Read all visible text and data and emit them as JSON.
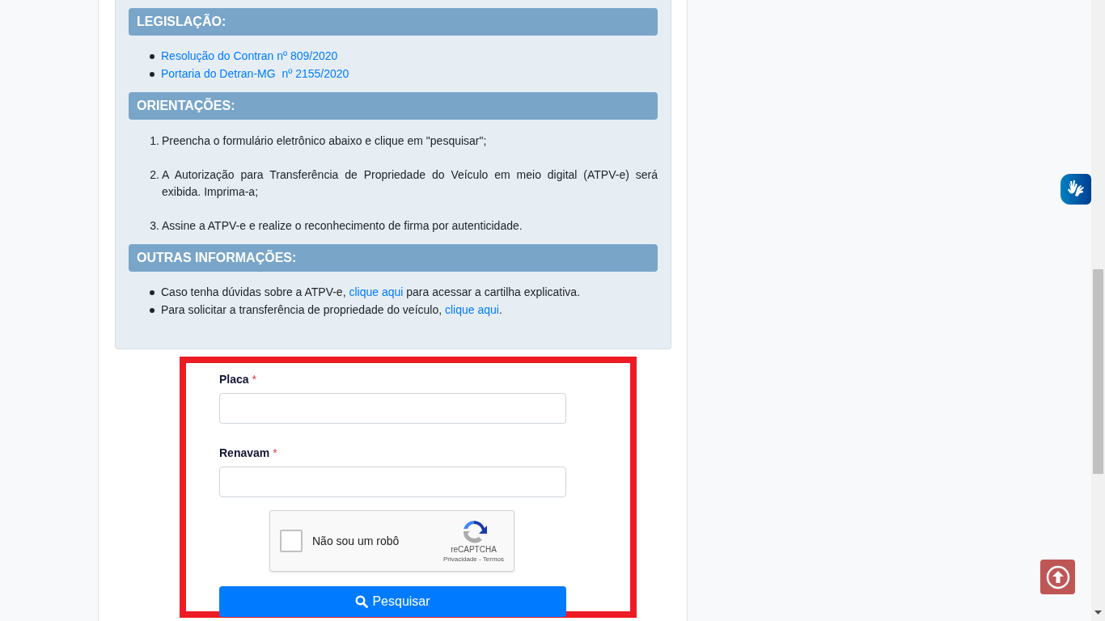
{
  "sections": [
    {
      "heading": "LEGISLAÇÃO:",
      "kind": "bullets",
      "items": [
        {
          "parts": [
            {
              "text": "Resolução do Contran nº 809/2020",
              "kind": "link"
            }
          ]
        },
        {
          "parts": [
            {
              "text": "Portaria do Detran-MG  nº 2155/2020",
              "kind": "link"
            }
          ]
        }
      ]
    },
    {
      "heading": "ORIENTAÇÕES:",
      "kind": "numbered",
      "items": [
        {
          "number": "1.",
          "parts": [
            {
              "text": "Preencha o formulário eletrônico abaixo e clique em \"pesquisar\";",
              "kind": "text"
            }
          ]
        },
        {
          "number": "2.",
          "parts": [
            {
              "text": "A Autorização para Transferência de Propriedade do Veículo em meio digital (ATPV-e) será exibida. Imprima-a;",
              "kind": "text"
            }
          ]
        },
        {
          "number": "3.",
          "parts": [
            {
              "text": "Assine a ATPV-e e realize o reconhecimento de firma por autenticidade.",
              "kind": "text"
            }
          ]
        }
      ]
    },
    {
      "heading": "OUTRAS INFORMAÇÕES:",
      "kind": "bullets",
      "items": [
        {
          "parts": [
            {
              "text": "Caso tenha dúvidas sobre a ATPV-e, ",
              "kind": "text"
            },
            {
              "text": "clique aqui",
              "kind": "link"
            },
            {
              "text": " para acessar a cartilha explicativa.",
              "kind": "text"
            }
          ]
        },
        {
          "parts": [
            {
              "text": "Para solicitar a transferência de propriedade do veículo, ",
              "kind": "text"
            },
            {
              "text": "clique aqui",
              "kind": "link"
            },
            {
              "text": ".",
              "kind": "text"
            }
          ]
        }
      ]
    }
  ],
  "form": {
    "fields": [
      {
        "label": "Placa",
        "required_mark": "*"
      },
      {
        "label": "Renavam",
        "required_mark": "*"
      }
    ],
    "captcha": {
      "label": "Não sou um robô",
      "checked": false,
      "brand": "reCAPTCHA",
      "terms": "Privacidade - Termos"
    },
    "button": "Pesquisar"
  }
}
